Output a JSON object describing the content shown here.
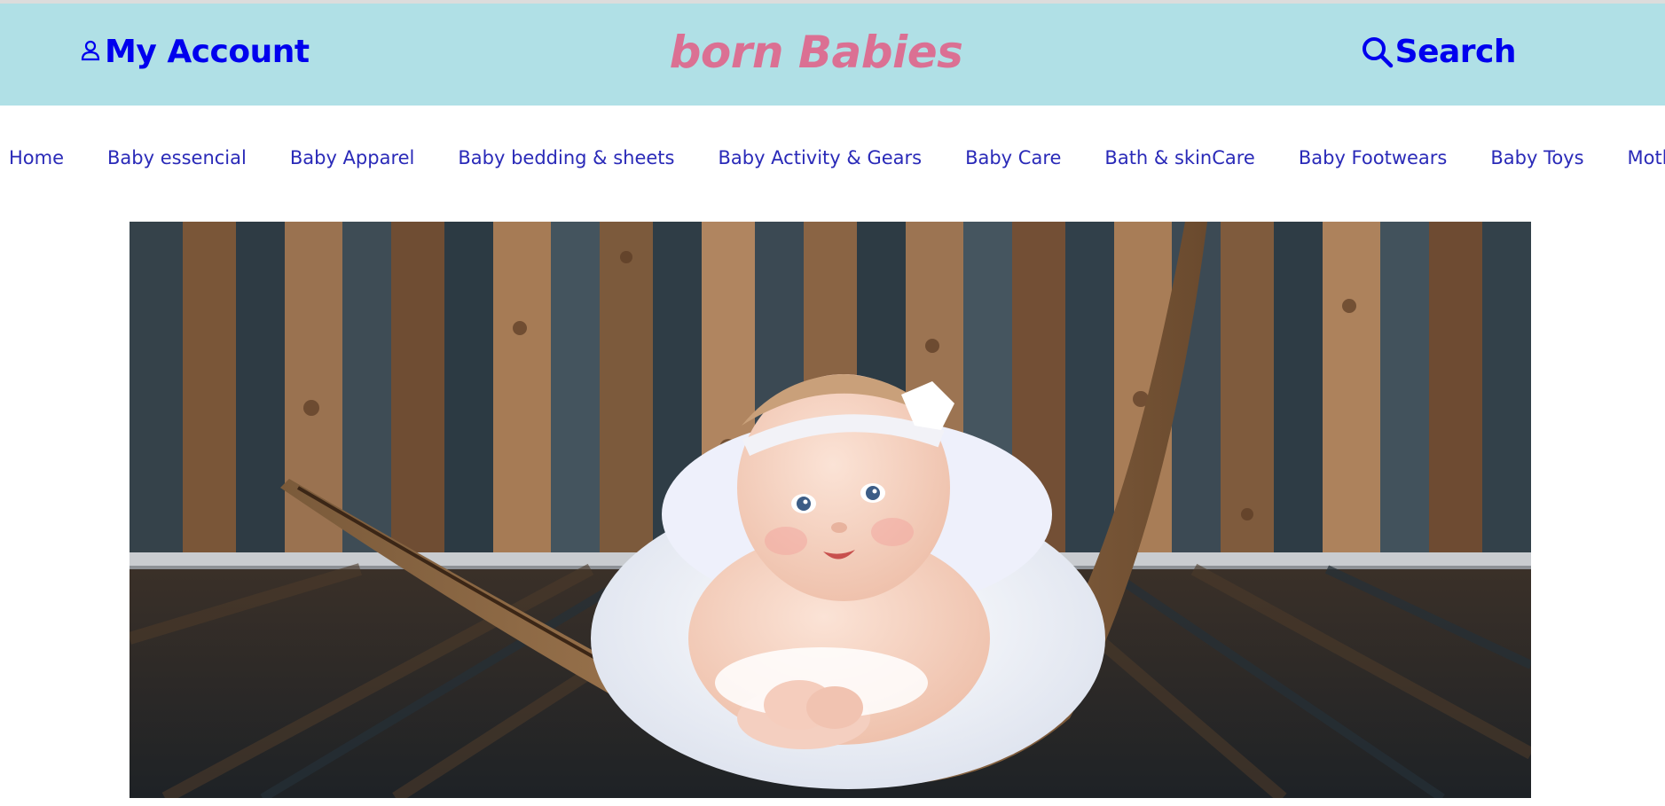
{
  "header": {
    "account_label": "My Account",
    "brand": "born Babies",
    "search_label": "Search"
  },
  "nav": {
    "items": [
      "Home",
      "Baby essencial",
      "Baby Apparel",
      "Baby bedding & sheets",
      "Baby Activity & Gears",
      "Baby Care",
      "Bath & skinCare",
      "Baby Footwears",
      "Baby Toys",
      "Mother care"
    ]
  },
  "colors": {
    "header_bg": "#b0e0e6",
    "brand": "#db7093",
    "link": "#0000ee",
    "nav_link": "#2a2ab8"
  },
  "hero": {
    "icon": "baby-on-palm-leaf-photo"
  }
}
